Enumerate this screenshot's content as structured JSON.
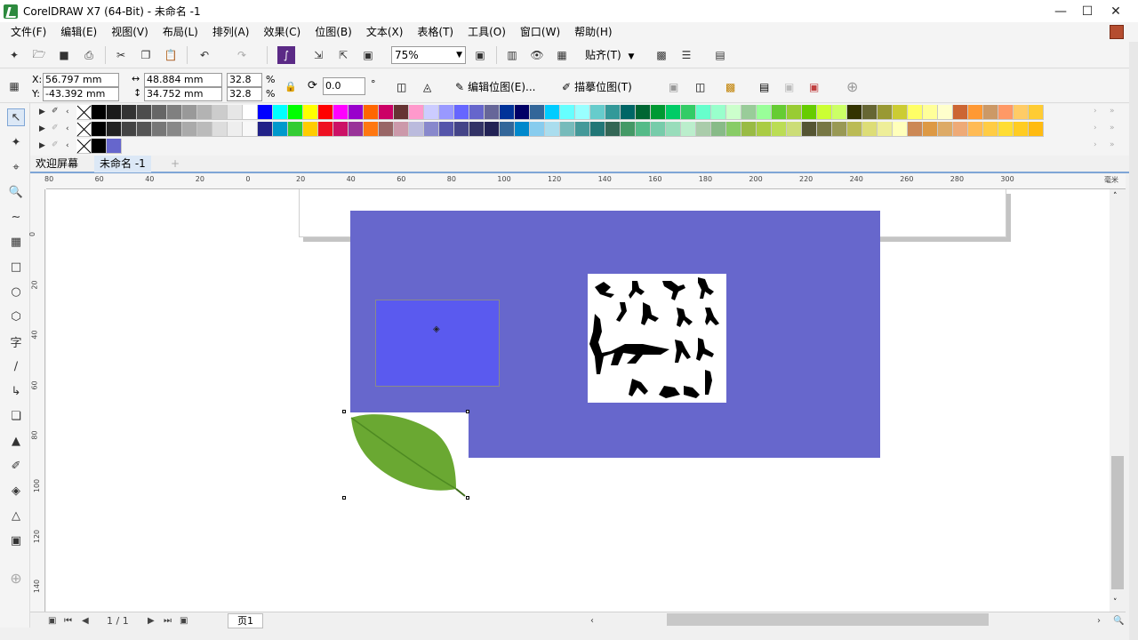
{
  "window": {
    "title": "CorelDRAW X7 (64-Bit) - 未命名 -1"
  },
  "menu": [
    "文件(F)",
    "编辑(E)",
    "视图(V)",
    "布局(L)",
    "排列(A)",
    "效果(C)",
    "位图(B)",
    "文本(X)",
    "表格(T)",
    "工具(O)",
    "窗口(W)",
    "帮助(H)"
  ],
  "toolbar": {
    "zoom": "75%",
    "snap_label": "贴齐(T)"
  },
  "property_bar": {
    "x_label": "X:",
    "x_value": "56.797 mm",
    "y_label": "Y:",
    "y_value": "-43.392 mm",
    "width_value": "48.884 mm",
    "height_value": "34.752 mm",
    "scale_w": "32.8",
    "scale_h": "32.8",
    "percent": "%",
    "rotation": "0.0",
    "degree": "°",
    "edit_bitmap": "编辑位图(E)...",
    "trace_bitmap": "描摹位图(T)"
  },
  "tabs": {
    "welcome": "欢迎屏幕",
    "document": "未命名 -1"
  },
  "ruler": {
    "h_labels": [
      "80",
      "60",
      "40",
      "20",
      "0",
      "20",
      "40",
      "60",
      "80",
      "100",
      "120",
      "140",
      "160",
      "180",
      "200",
      "220",
      "240",
      "260",
      "280",
      "300"
    ],
    "unit": "毫米",
    "v_labels": [
      "0",
      "20",
      "40",
      "60",
      "80",
      "100",
      "120",
      "140"
    ]
  },
  "navigation": {
    "page_counter": "1 / 1",
    "page_tab": "页1"
  },
  "palette": {
    "row1": [
      "#000000",
      "#1a1a1a",
      "#333333",
      "#4d4d4d",
      "#666666",
      "#808080",
      "#999999",
      "#b3b3b3",
      "#cccccc",
      "#e6e6e6",
      "#ffffff",
      "#0000ff",
      "#00ffff",
      "#00ff00",
      "#ffff00",
      "#ff0000",
      "#ff00ff",
      "#9900cc",
      "#ff6600",
      "#cc0066",
      "#663333",
      "#ff99cc",
      "#ccccff",
      "#9999ff",
      "#6666ff",
      "#6666cc",
      "#666699",
      "#003399",
      "#000066",
      "#336699",
      "#00ccff",
      "#66ffff",
      "#99ffff",
      "#66cccc",
      "#339999",
      "#006666",
      "#006633",
      "#009933",
      "#00cc66",
      "#33cc66",
      "#66ffcc",
      "#99ffcc",
      "#ccffcc",
      "#99cc99",
      "#99ff99",
      "#66cc33",
      "#99cc33",
      "#66cc00",
      "#ccff33",
      "#ccff66",
      "#333300",
      "#666633",
      "#999933",
      "#cccc33",
      "#ffff66",
      "#ffff99",
      "#ffffcc",
      "#cc6633",
      "#ff9933",
      "#cc9966",
      "#ff9966",
      "#ffcc66",
      "#ffcc33"
    ],
    "row2": [
      "#000000",
      "#222222",
      "#444444",
      "#555555",
      "#777777",
      "#888888",
      "#aaaaaa",
      "#bbbbbb",
      "#dddddd",
      "#eeeeee",
      "#f8f8f8",
      "#222288",
      "#0099cc",
      "#33cc33",
      "#ffcc00",
      "#ee1122",
      "#cc1166",
      "#993399",
      "#ff7711",
      "#996666",
      "#cc99aa",
      "#bbbbdd",
      "#8888cc",
      "#5555aa",
      "#444488",
      "#333366",
      "#222255",
      "#336699",
      "#0088cc",
      "#88ccee",
      "#aaddee",
      "#77bbbb",
      "#449999",
      "#227777",
      "#336655",
      "#449966",
      "#55bb88",
      "#77ccaa",
      "#99ddbb",
      "#bbeecc",
      "#aaccaa",
      "#88bb88",
      "#88cc66",
      "#99bb44",
      "#aacc44",
      "#bbdd55",
      "#ccdd77",
      "#555533",
      "#777744",
      "#999955",
      "#bbbb55",
      "#dddd77",
      "#eeee99",
      "#ffffbb",
      "#cc8855",
      "#dd9944",
      "#ddaa66",
      "#eeaa77",
      "#ffbb55",
      "#ffcc44",
      "#ffdd33",
      "#ffcc22",
      "#ffbb11"
    ],
    "row3": [
      "#000000",
      "#6666cc"
    ]
  },
  "colors": {
    "accent_blue": "#6767cc",
    "selected_fill": "#5a5aef"
  }
}
